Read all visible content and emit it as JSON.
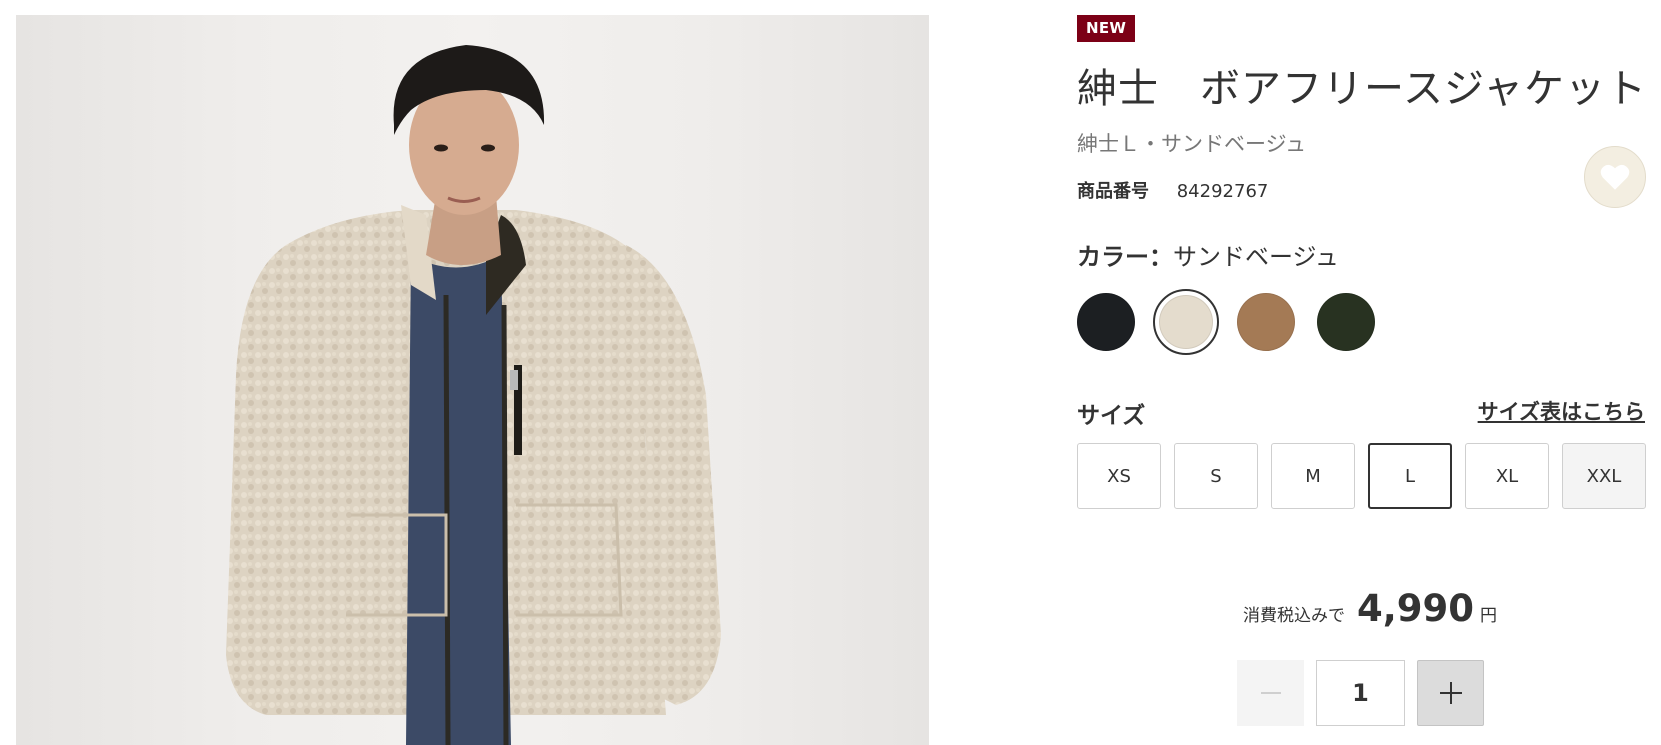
{
  "product": {
    "badge": "NEW",
    "title": "紳士　ボアフリースジャケット",
    "subtitle": "紳士Ｌ・サンドベージュ",
    "number_label": "商品番号",
    "number_value": "84292767"
  },
  "color": {
    "label": "カラー：",
    "selected_name": "サンドベージュ",
    "swatches": [
      {
        "name": "black",
        "hex": "#1c1f22",
        "selected": false
      },
      {
        "name": "sand-beige",
        "hex": "#e4dccd",
        "selected": true
      },
      {
        "name": "brown",
        "hex": "#a47a55",
        "selected": false
      },
      {
        "name": "dark-olive",
        "hex": "#283221",
        "selected": false
      }
    ]
  },
  "size": {
    "label": "サイズ",
    "guide_link": "サイズ表はこちら",
    "options": [
      "XS",
      "S",
      "M",
      "L",
      "XL",
      "XXL"
    ],
    "selected": "L"
  },
  "price": {
    "prefix": "消費税込みで",
    "value": "4,990",
    "unit": "円"
  },
  "quantity": {
    "value": "1"
  },
  "colors": {
    "badge": "#7c0016",
    "text": "#333333",
    "favorite_bg": "#f3eee1"
  },
  "icons": [
    "heart-icon",
    "minus-icon",
    "plus-icon"
  ]
}
